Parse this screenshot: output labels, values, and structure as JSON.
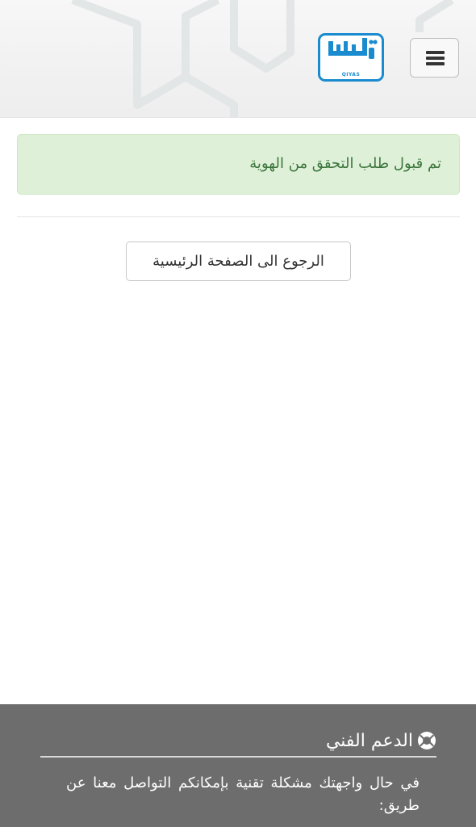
{
  "header": {
    "logo": {
      "icon": "qiyas-logo",
      "wordmark": "قياس",
      "latin": "QIYAS",
      "brand_color": "#1b8bd0"
    },
    "menu_icon": "hamburger-menu-icon"
  },
  "alert": {
    "message": "تم قبول طلب التحقق من الهوية",
    "background_color": "#dff0d8",
    "text_color": "#3c763d"
  },
  "actions": {
    "home_button_label": "الرجوع الى الصفحة الرئيسية"
  },
  "footer": {
    "support_icon": "lifebuoy-icon",
    "support_title": "الدعم الفني",
    "support_text": "في حال واجهتك مشكلة تقنية بإمكانكم التواصل معنا عن طريق:",
    "background_color": "#6d6d6d"
  }
}
